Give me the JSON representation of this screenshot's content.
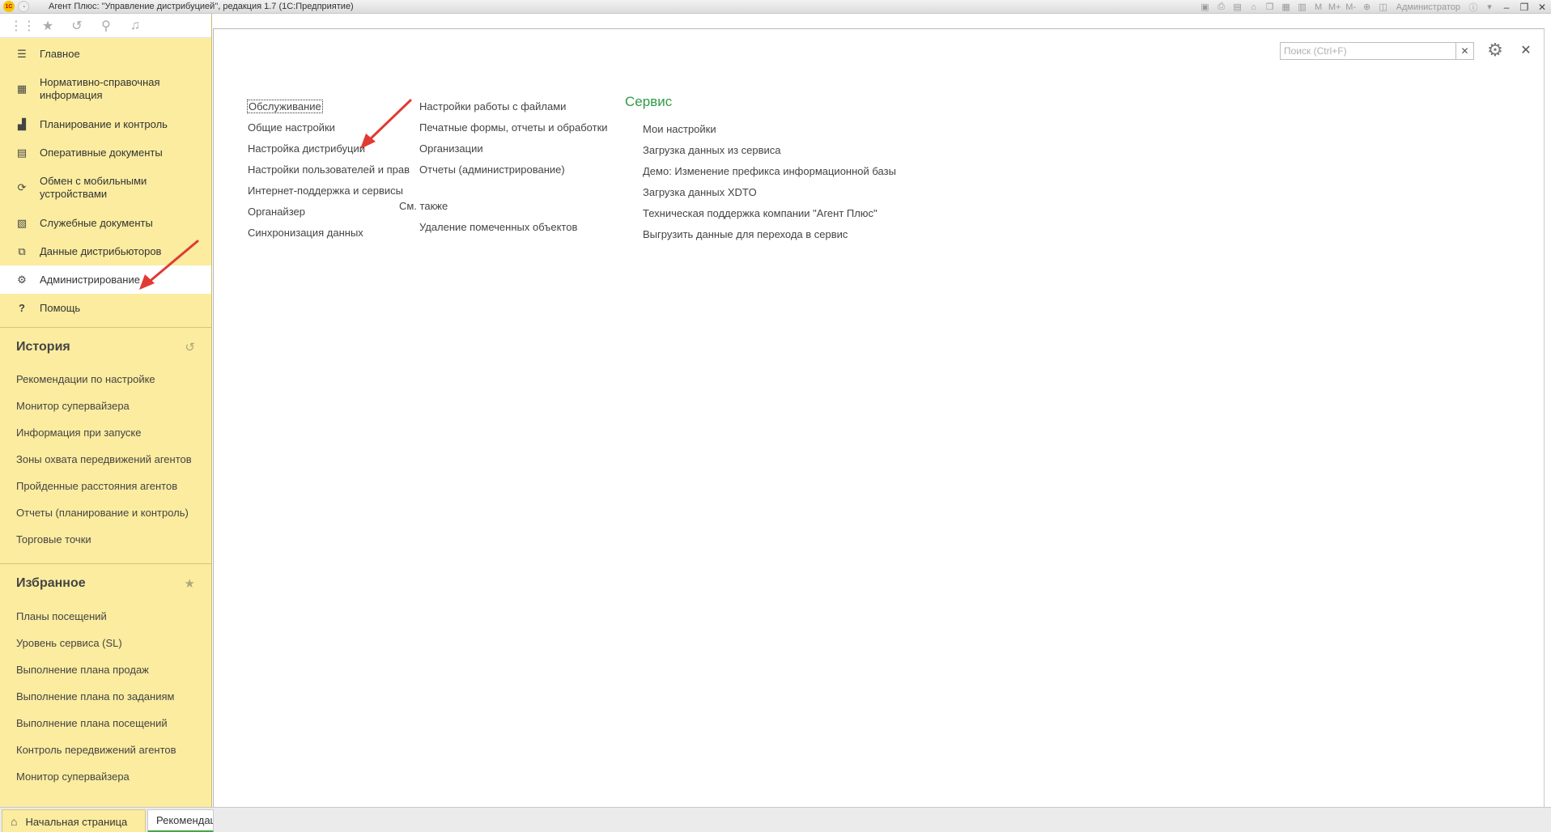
{
  "titlebar": {
    "logo_text": "1С",
    "title": "Агент Плюс: \"Управление дистрибуцией\", редакция 1.7  (1С:Предприятие)",
    "tool_letters": [
      "M",
      "M+",
      "M-"
    ],
    "user": "Администратор"
  },
  "sidebar": {
    "nav": [
      {
        "label": "Главное",
        "icon": "menu-lines-icon"
      },
      {
        "label": "Нормативно-справочная информация",
        "icon": "grid-icon"
      },
      {
        "label": "Планирование и контроль",
        "icon": "bar-chart-icon"
      },
      {
        "label": "Оперативные документы",
        "icon": "documents-icon"
      },
      {
        "label": "Обмен с мобильными устройствами",
        "icon": "sync-icon"
      },
      {
        "label": "Служебные документы",
        "icon": "service-docs-icon"
      },
      {
        "label": "Данные дистрибьюторов",
        "icon": "distributor-data-icon"
      },
      {
        "label": "Администрирование",
        "icon": "gear-icon",
        "active": true
      },
      {
        "label": "Помощь",
        "icon": "question-icon"
      }
    ],
    "history": {
      "title": "История",
      "items": [
        "Рекомендации по настройке",
        "Монитор супервайзера",
        "Информация при запуске",
        "Зоны охвата передвижений агентов",
        "Пройденные расстояния агентов",
        "Отчеты (планирование и контроль)",
        "Торговые точки"
      ]
    },
    "favorites": {
      "title": "Избранное",
      "items": [
        "Планы посещений",
        "Уровень сервиса (SL)",
        "Выполнение плана продаж",
        "Выполнение плана по заданиям",
        "Выполнение плана посещений",
        "Контроль передвижений агентов",
        "Монитор супервайзера"
      ]
    }
  },
  "content": {
    "search": {
      "placeholder": "Поиск (Ctrl+F)",
      "value": ""
    },
    "col1": [
      "Обслуживание",
      "Общие настройки",
      "Настройка дистрибуции",
      "Настройки пользователей и прав",
      "Интернет-поддержка и сервисы",
      "Органайзер",
      "Синхронизация данных"
    ],
    "col2": [
      "Настройки работы с файлами",
      "Печатные формы, отчеты и обработки",
      "Организации",
      "Отчеты (администрирование)"
    ],
    "see_also": {
      "title": "См. также",
      "items": [
        "Удаление помеченных объектов"
      ]
    },
    "service": {
      "title": "Сервис",
      "items": [
        "Мои настройки",
        "Загрузка данных из сервиса",
        "Демо: Изменение префикса информационной базы",
        "Загрузка данных XDTO",
        "Техническая поддержка компании \"Агент Плюс\"",
        "Выгрузить данные для перехода в сервис"
      ]
    }
  },
  "tabs": {
    "home": "Начальная страница",
    "recommendations": "Рекомендации по настройке"
  },
  "colors": {
    "sidebar_bg": "#fbec9f",
    "service_title": "#2e9a45",
    "arrow": "#e03a32",
    "active_tab_underline": "#49a449"
  }
}
